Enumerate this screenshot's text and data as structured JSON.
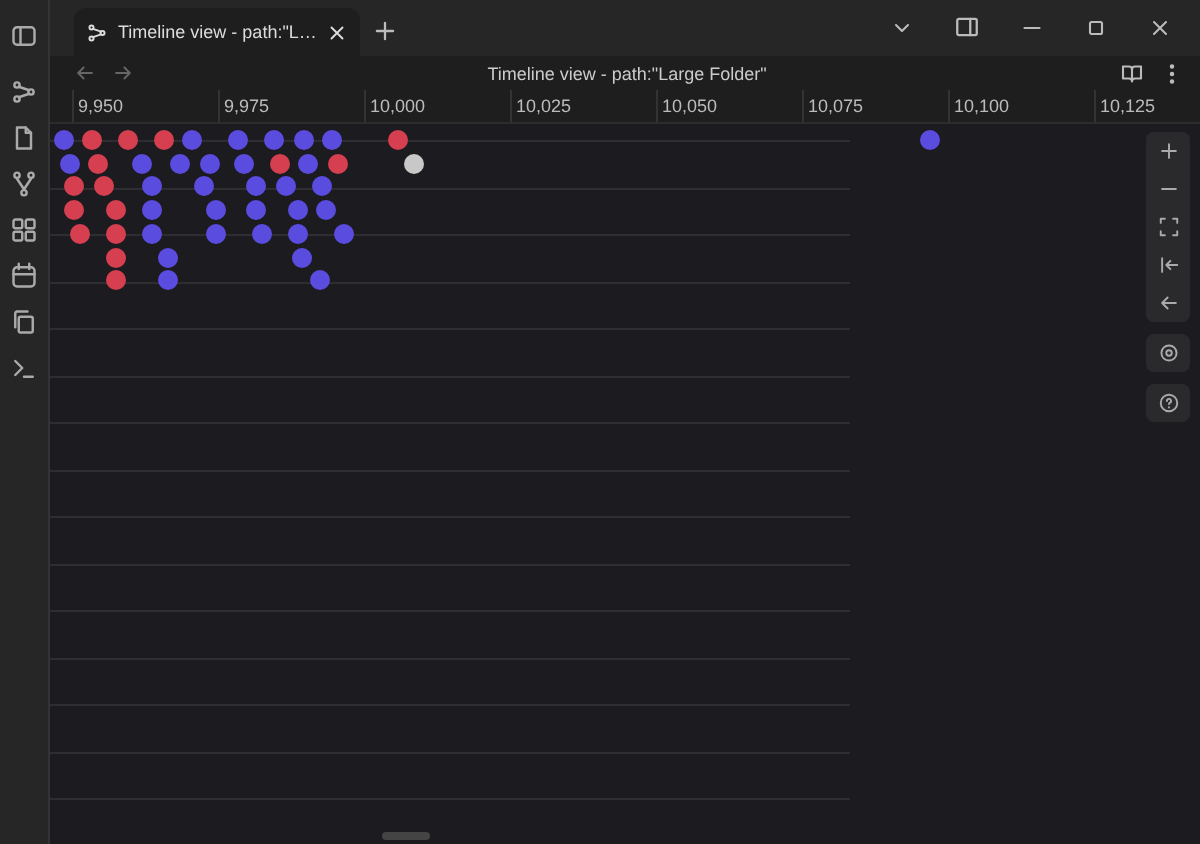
{
  "tabs": [
    {
      "title": "Timeline view - path:\"L…",
      "selected": true
    }
  ],
  "view": {
    "title": "Timeline view - path:\"Large Folder\""
  },
  "ruler": {
    "ticks": [
      "9,950",
      "9,975",
      "10,000",
      "10,025",
      "10,050",
      "10,075",
      "10,100",
      "10,125"
    ]
  },
  "timeline": {
    "items": [
      {
        "color": "#5b4ce0"
      },
      {
        "color": "#d63f50"
      },
      {
        "color": "#d63f50"
      },
      {
        "color": "#d63f50"
      },
      {
        "color": "#5b4ce0"
      },
      {
        "color": "#5b4ce0"
      },
      {
        "color": "#5b4ce0"
      },
      {
        "color": "#5b4ce0"
      },
      {
        "color": "#5b4ce0"
      },
      {
        "color": "#d63f50"
      },
      {
        "color": "#5b4ce0"
      },
      {
        "color": "#5b4ce0"
      },
      {
        "color": "#d63f50"
      },
      {
        "color": "#5b4ce0"
      },
      {
        "color": "#5b4ce0"
      },
      {
        "color": "#5b4ce0"
      },
      {
        "color": "#5b4ce0"
      },
      {
        "color": "#d63f50"
      },
      {
        "color": "#5b4ce0"
      },
      {
        "color": "#d63f50"
      },
      {
        "color": "#c8c8c8"
      },
      {
        "color": "#d63f50"
      },
      {
        "color": "#d63f50"
      },
      {
        "color": "#5b4ce0"
      },
      {
        "color": "#5b4ce0"
      },
      {
        "color": "#5b4ce0"
      },
      {
        "color": "#5b4ce0"
      },
      {
        "color": "#5b4ce0"
      },
      {
        "color": "#d63f50"
      },
      {
        "color": "#d63f50"
      },
      {
        "color": "#5b4ce0"
      },
      {
        "color": "#5b4ce0"
      },
      {
        "color": "#5b4ce0"
      },
      {
        "color": "#5b4ce0"
      },
      {
        "color": "#5b4ce0"
      },
      {
        "color": "#d63f50"
      },
      {
        "color": "#d63f50"
      },
      {
        "color": "#5b4ce0"
      },
      {
        "color": "#5b4ce0"
      },
      {
        "color": "#5b4ce0"
      },
      {
        "color": "#5b4ce0"
      },
      {
        "color": "#5b4ce0"
      },
      {
        "color": "#d63f50"
      },
      {
        "color": "#5b4ce0"
      },
      {
        "color": "#5b4ce0"
      },
      {
        "color": "#d63f50"
      },
      {
        "color": "#5b4ce0"
      },
      {
        "color": "#5b4ce0"
      }
    ]
  }
}
